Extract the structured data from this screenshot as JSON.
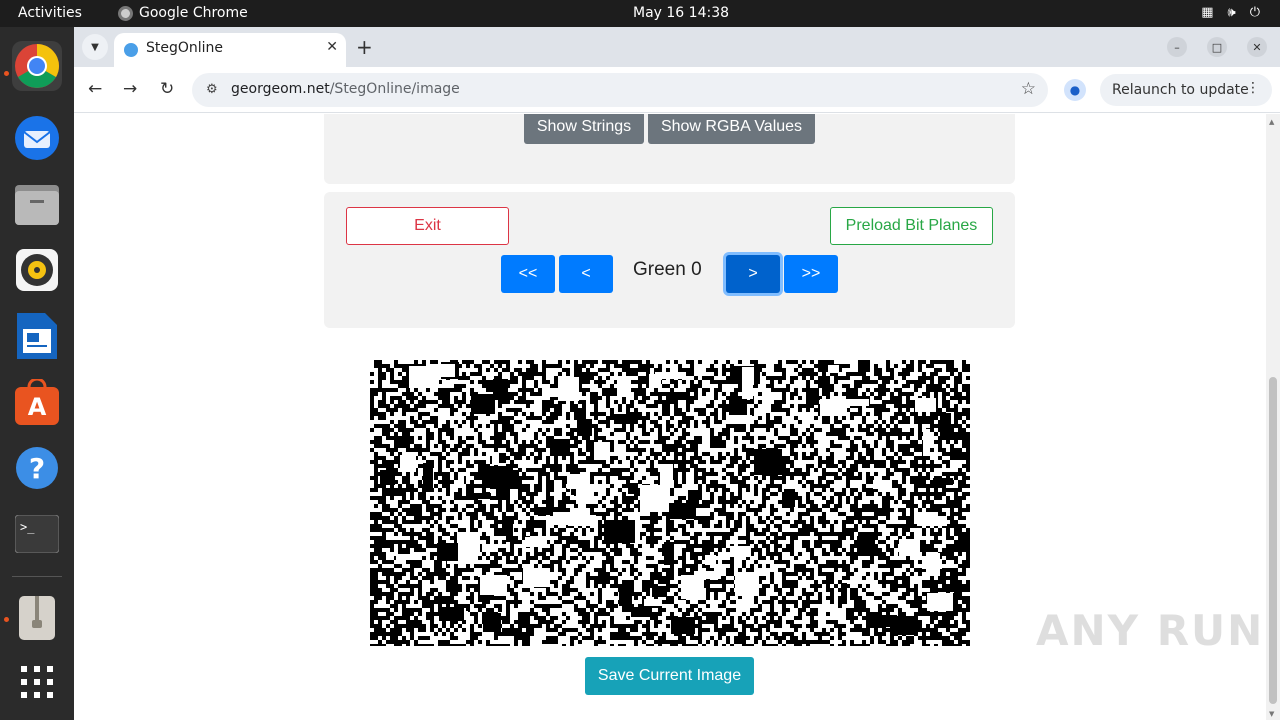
{
  "topbar": {
    "activities": "Activities",
    "app_name": "Google Chrome",
    "clock": "May 16  14:38"
  },
  "dock": {
    "icons": [
      "chrome-icon",
      "thunderbird-icon",
      "files-icon",
      "rhythmbox-icon",
      "libreoffice-writer-icon",
      "app-center-icon",
      "help-icon",
      "terminal-icon",
      "archive-icon",
      "show-apps-icon"
    ]
  },
  "browser": {
    "tab_title": "StegOnline",
    "url_domain": "georgeom.net",
    "url_path": "/StegOnline/image",
    "relaunch_label": "Relaunch to update"
  },
  "page": {
    "show_strings": "Show Strings",
    "show_rgba": "Show RGBA Values",
    "exit": "Exit",
    "preload": "Preload Bit Planes",
    "first": "<<",
    "prev": "<",
    "plane_label": "Green 0",
    "next": ">",
    "last": ">>",
    "save": "Save Current Image"
  },
  "watermark": "ANY RUN"
}
